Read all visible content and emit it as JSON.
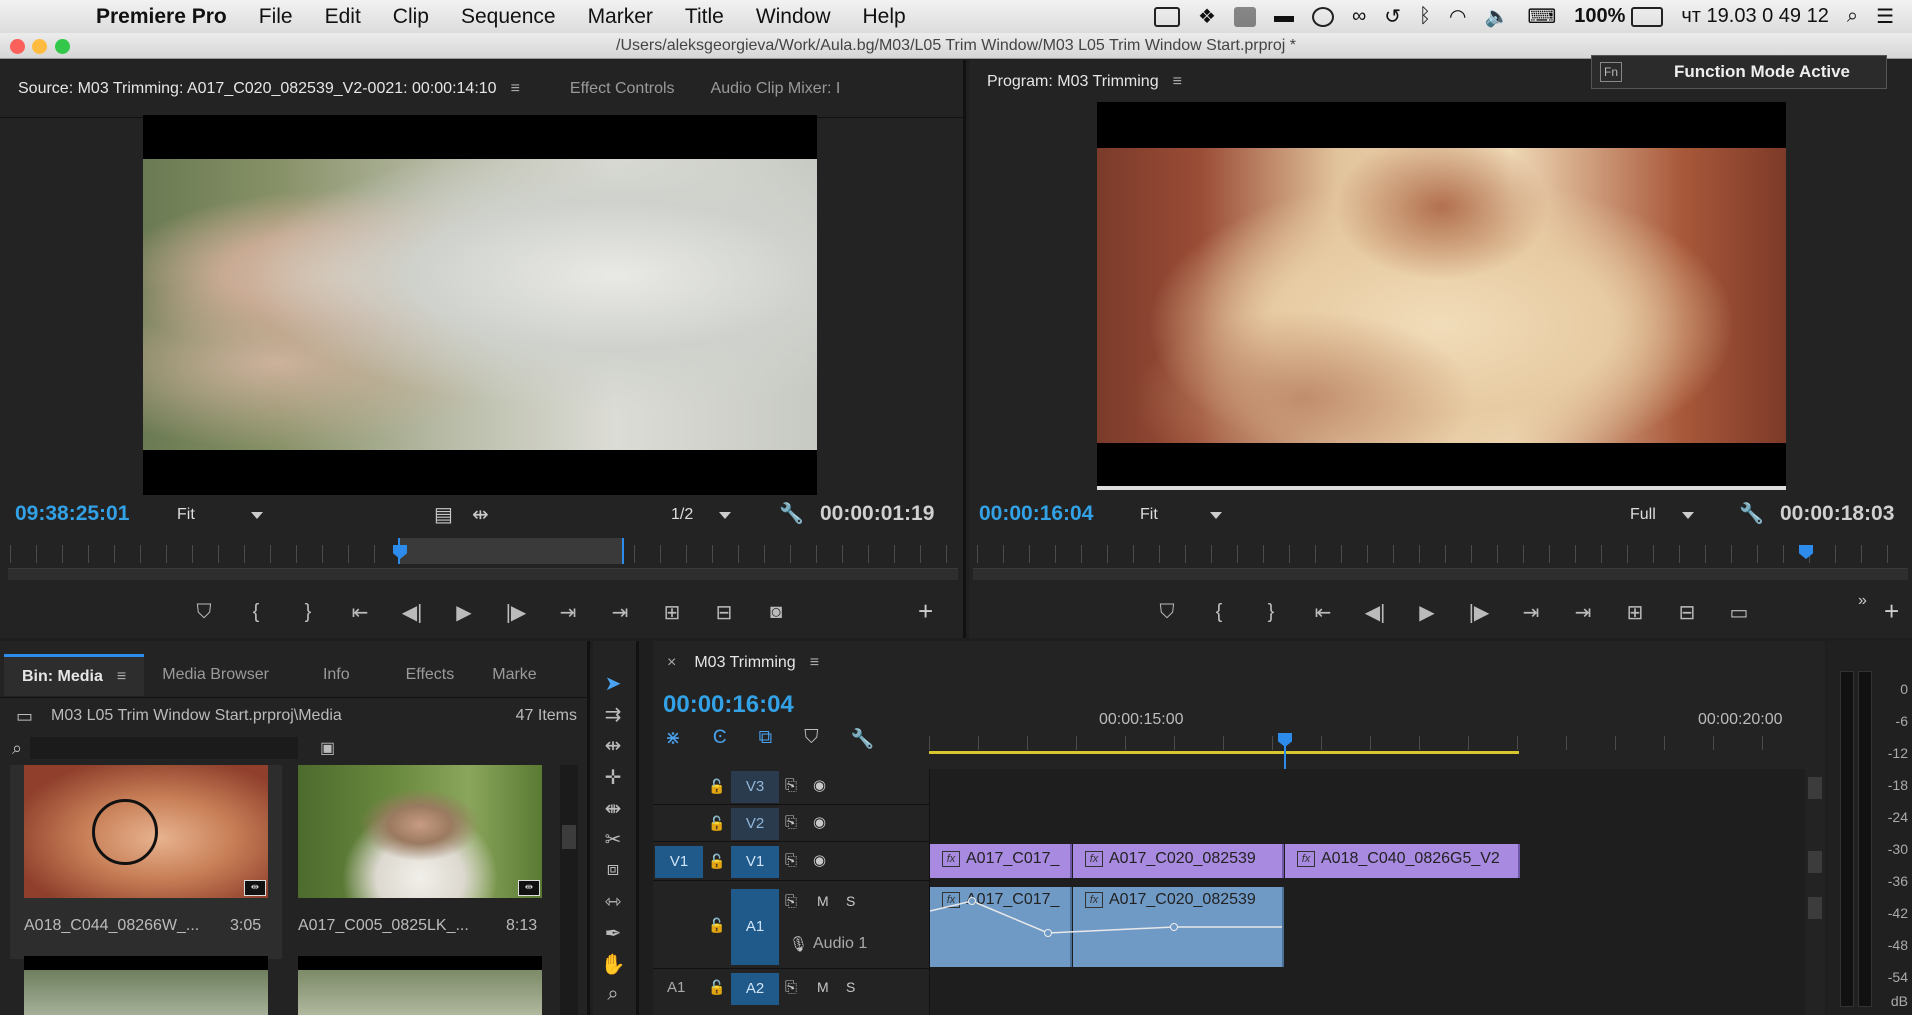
{
  "menubar": {
    "app_name": "Premiere Pro",
    "items": [
      "File",
      "Edit",
      "Clip",
      "Sequence",
      "Marker",
      "Title",
      "Window",
      "Help"
    ],
    "battery": "100%",
    "clock": "чт 19.03  0 49 12"
  },
  "window": {
    "path": "/Users/aleksgeorgieva/Work/Aula.bg/M03/L05 Trim Window/M03 L05 Trim Window Start.prproj *"
  },
  "function_mode": {
    "fn": "Fn",
    "label": "Function Mode Active"
  },
  "source_monitor": {
    "tabs": [
      "Source: M03 Trimming: A017_C020_082539_V2-0021: 00:00:14:10",
      "Effect Controls",
      "Audio Clip Mixer: I"
    ],
    "timecode_current": "09:38:25:01",
    "zoom": "Fit",
    "resolution": "1/2",
    "timecode_duration": "00:00:01:19"
  },
  "program_monitor": {
    "tab": "Program: M03 Trimming",
    "timecode_current": "00:00:16:04",
    "zoom": "Fit",
    "resolution": "Full",
    "timecode_duration": "00:00:18:03"
  },
  "project": {
    "tabs": [
      "Bin: Media",
      "Media Browser",
      "Info",
      "Effects",
      "Marke"
    ],
    "path": "M03 L05 Trim Window Start.prproj\\Media",
    "count": "47 Items",
    "clips": [
      {
        "name": "A018_C044_08266W_...",
        "duration": "3:05"
      },
      {
        "name": "A017_C005_0825LK_...",
        "duration": "8:13"
      }
    ]
  },
  "timeline": {
    "tab": "M03 Trimming",
    "timecode": "00:00:16:04",
    "ruler_labels": [
      "00:00:15:00",
      "00:00:20:00"
    ],
    "tracks": {
      "v3": "V3",
      "v2": "V2",
      "v1_src": "V1",
      "v1": "V1",
      "a1": "A1",
      "a1_src": "A1",
      "a2": "A2",
      "m": "M",
      "s": "S",
      "audio_name": "Audio 1"
    },
    "video_clips": [
      "A017_C017_",
      "A017_C020_082539",
      "A018_C040_0826G5_V2"
    ],
    "audio_clips": [
      "A017_C017_",
      "A017_C020_082539"
    ]
  },
  "meter": {
    "scale": [
      "0",
      "-6",
      "-12",
      "-18",
      "-24",
      "-30",
      "-36",
      "-42",
      "-48",
      "-54",
      "dB"
    ]
  }
}
